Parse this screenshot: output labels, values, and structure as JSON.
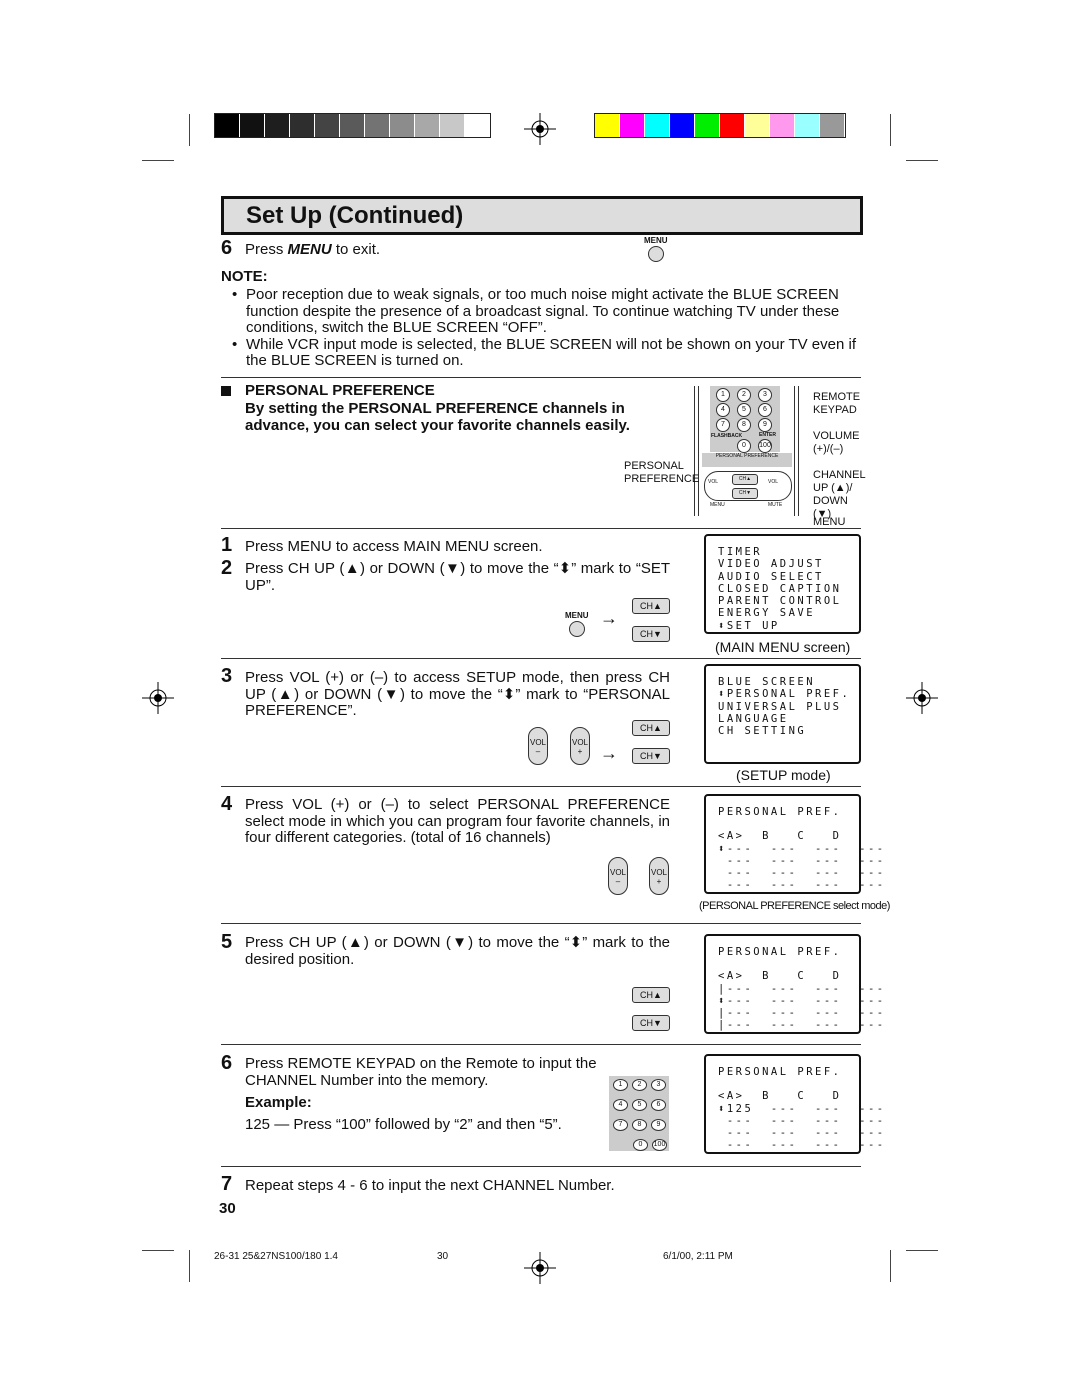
{
  "colors": {
    "gray_bars": [
      "#000000",
      "#111111",
      "#1e1e1e",
      "#2e2e2e",
      "#444444",
      "#5a5a5a",
      "#737373",
      "#8c8c8c",
      "#a8a8a8",
      "#c8c8c8",
      "#ffffff"
    ],
    "color_bars": [
      "#ffff00",
      "#ff00ff",
      "#00ffff",
      "#0000ff",
      "#00ee00",
      "#ff0000",
      "#ffff99",
      "#ff99ee",
      "#99ffff",
      "#999999"
    ]
  },
  "header": {
    "title": "Set Up (Continued)"
  },
  "step6_exit": {
    "num": "6",
    "pre": "Press ",
    "key": "MENU",
    "post": " to exit.",
    "icon_label": "MENU"
  },
  "note": {
    "heading": "NOTE:",
    "bullets": [
      "Poor reception due to weak signals, or too much noise might activate the BLUE SCREEN function despite the presence of a broadcast signal. To continue watching TV under these conditions, switch the BLUE SCREEN “OFF”.",
      "While VCR input mode is selected, the BLUE SCREEN will not be shown on your TV even if the BLUE SCREEN is turned on."
    ]
  },
  "section": {
    "heading": "PERSONAL PREFERENCE",
    "intro": "By setting the PERSONAL PREFERENCE channels in advance, you can select your favorite channels easily."
  },
  "remote": {
    "labels": {
      "keypad": "REMOTE KEYPAD",
      "volume": "VOLUME (+)/(–)",
      "channel": "CHANNEL UP (▲)/ DOWN (▼)",
      "menu": "MENU",
      "pp": "PERSONAL PREFERENCE"
    },
    "keys": [
      "1",
      "2",
      "3",
      "4",
      "5",
      "6",
      "7",
      "8",
      "9",
      "0",
      "100"
    ],
    "flashback": "FLASHBACK",
    "enter": "ENTER",
    "pp_bar": "PERSONAL PREFERENCE",
    "vol": "VOL",
    "ch_up": "CH▲",
    "ch_down": "CH▼",
    "menu": "MENU",
    "mute": "MUTE"
  },
  "buttons": {
    "menu": "MENU",
    "ch_up": "CH▲",
    "ch_down": "CH▼",
    "vol_minus": "VOL –",
    "vol_plus": "VOL +",
    "arrow": "→"
  },
  "steps": [
    {
      "num": "1",
      "text": "Press MENU to access MAIN MENU screen."
    },
    {
      "num": "2",
      "text": "Press CH UP (▲) or DOWN (▼) to move the “⬍” mark to “SET UP”."
    },
    {
      "num": "3",
      "text": "Press VOL (+) or (–) to access SETUP mode, then press CH UP (▲) or DOWN (▼) to move the “⬍” mark to “PERSONAL PREFERENCE”."
    },
    {
      "num": "4",
      "text": "Press VOL (+) or (–) to select PERSONAL PREFERENCE select mode in which you can program four favorite channels, in four different categories. (total of 16 channels)"
    },
    {
      "num": "5",
      "text": "Press CH UP (▲) or DOWN (▼) to move the “⬍” mark to the desired position."
    },
    {
      "num": "6",
      "text": "Press REMOTE KEYPAD on the Remote to input the CHANNEL Number into the memory.",
      "example_label": "Example:",
      "example": "125 — Press “100” followed by “2” and then “5”."
    },
    {
      "num": "7",
      "text": "Repeat steps 4 - 6 to input the next CHANNEL Number."
    }
  ],
  "screens": {
    "main_menu": {
      "lines": [
        "TIMER",
        "VIDEO ADJUST",
        "AUDIO SELECT",
        "CLOSED CAPTION",
        "PARENT CONTROL",
        "ENERGY SAVE",
        "⬍SET UP"
      ],
      "caption": "(MAIN MENU screen)"
    },
    "setup": {
      "lines": [
        "BLUE SCREEN",
        "⬍PERSONAL PREF.",
        "UNIVERSAL PLUS",
        "LANGUAGE",
        "CH SETTING"
      ],
      "caption": "(SETUP mode)"
    },
    "pp1": {
      "lines": [
        "PERSONAL PREF.",
        "",
        "<A>  B   C   D",
        "⬍---  ---  ---  ---",
        " ---  ---  ---  ---",
        " ---  ---  ---  ---",
        " ---  ---  ---  ---"
      ],
      "caption": "(PERSONAL PREFERENCE select mode)"
    },
    "pp2": {
      "lines": [
        "PERSONAL PREF.",
        "",
        "<A>  B   C   D",
        "|---  ---  ---  ---",
        "⬍---  ---  ---  ---",
        "|---  ---  ---  ---",
        "|---  ---  ---  ---"
      ]
    },
    "pp3": {
      "lines": [
        "PERSONAL PREF.",
        "",
        "<A>  B   C   D",
        "⬍125  ---  ---  ---",
        " ---  ---  ---  ---",
        " ---  ---  ---  ---",
        " ---  ---  ---  ---"
      ]
    }
  },
  "page_number": "30",
  "footer": {
    "left": "26-31 25&27NS100/180 1.4",
    "center": "30",
    "right": "6/1/00, 2:11 PM"
  }
}
